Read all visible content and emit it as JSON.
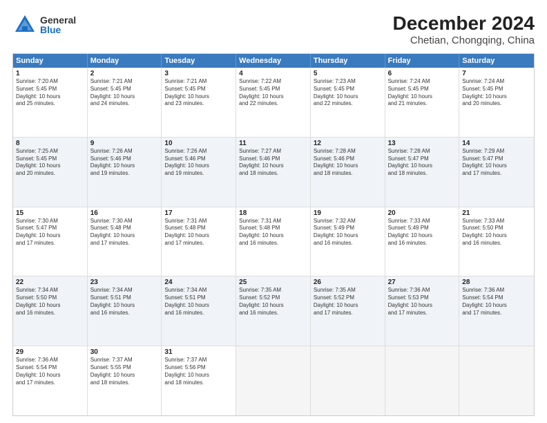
{
  "header": {
    "logo_general": "General",
    "logo_blue": "Blue",
    "title": "December 2024",
    "location": "Chetian, Chongqing, China"
  },
  "weekdays": [
    "Sunday",
    "Monday",
    "Tuesday",
    "Wednesday",
    "Thursday",
    "Friday",
    "Saturday"
  ],
  "rows": [
    [
      {
        "day": "1",
        "lines": [
          "Sunrise: 7:20 AM",
          "Sunset: 5:45 PM",
          "Daylight: 10 hours",
          "and 25 minutes."
        ]
      },
      {
        "day": "2",
        "lines": [
          "Sunrise: 7:21 AM",
          "Sunset: 5:45 PM",
          "Daylight: 10 hours",
          "and 24 minutes."
        ]
      },
      {
        "day": "3",
        "lines": [
          "Sunrise: 7:21 AM",
          "Sunset: 5:45 PM",
          "Daylight: 10 hours",
          "and 23 minutes."
        ]
      },
      {
        "day": "4",
        "lines": [
          "Sunrise: 7:22 AM",
          "Sunset: 5:45 PM",
          "Daylight: 10 hours",
          "and 22 minutes."
        ]
      },
      {
        "day": "5",
        "lines": [
          "Sunrise: 7:23 AM",
          "Sunset: 5:45 PM",
          "Daylight: 10 hours",
          "and 22 minutes."
        ]
      },
      {
        "day": "6",
        "lines": [
          "Sunrise: 7:24 AM",
          "Sunset: 5:45 PM",
          "Daylight: 10 hours",
          "and 21 minutes."
        ]
      },
      {
        "day": "7",
        "lines": [
          "Sunrise: 7:24 AM",
          "Sunset: 5:45 PM",
          "Daylight: 10 hours",
          "and 20 minutes."
        ]
      }
    ],
    [
      {
        "day": "8",
        "lines": [
          "Sunrise: 7:25 AM",
          "Sunset: 5:45 PM",
          "Daylight: 10 hours",
          "and 20 minutes."
        ]
      },
      {
        "day": "9",
        "lines": [
          "Sunrise: 7:26 AM",
          "Sunset: 5:46 PM",
          "Daylight: 10 hours",
          "and 19 minutes."
        ]
      },
      {
        "day": "10",
        "lines": [
          "Sunrise: 7:26 AM",
          "Sunset: 5:46 PM",
          "Daylight: 10 hours",
          "and 19 minutes."
        ]
      },
      {
        "day": "11",
        "lines": [
          "Sunrise: 7:27 AM",
          "Sunset: 5:46 PM",
          "Daylight: 10 hours",
          "and 18 minutes."
        ]
      },
      {
        "day": "12",
        "lines": [
          "Sunrise: 7:28 AM",
          "Sunset: 5:46 PM",
          "Daylight: 10 hours",
          "and 18 minutes."
        ]
      },
      {
        "day": "13",
        "lines": [
          "Sunrise: 7:28 AM",
          "Sunset: 5:47 PM",
          "Daylight: 10 hours",
          "and 18 minutes."
        ]
      },
      {
        "day": "14",
        "lines": [
          "Sunrise: 7:29 AM",
          "Sunset: 5:47 PM",
          "Daylight: 10 hours",
          "and 17 minutes."
        ]
      }
    ],
    [
      {
        "day": "15",
        "lines": [
          "Sunrise: 7:30 AM",
          "Sunset: 5:47 PM",
          "Daylight: 10 hours",
          "and 17 minutes."
        ]
      },
      {
        "day": "16",
        "lines": [
          "Sunrise: 7:30 AM",
          "Sunset: 5:48 PM",
          "Daylight: 10 hours",
          "and 17 minutes."
        ]
      },
      {
        "day": "17",
        "lines": [
          "Sunrise: 7:31 AM",
          "Sunset: 5:48 PM",
          "Daylight: 10 hours",
          "and 17 minutes."
        ]
      },
      {
        "day": "18",
        "lines": [
          "Sunrise: 7:31 AM",
          "Sunset: 5:48 PM",
          "Daylight: 10 hours",
          "and 16 minutes."
        ]
      },
      {
        "day": "19",
        "lines": [
          "Sunrise: 7:32 AM",
          "Sunset: 5:49 PM",
          "Daylight: 10 hours",
          "and 16 minutes."
        ]
      },
      {
        "day": "20",
        "lines": [
          "Sunrise: 7:33 AM",
          "Sunset: 5:49 PM",
          "Daylight: 10 hours",
          "and 16 minutes."
        ]
      },
      {
        "day": "21",
        "lines": [
          "Sunrise: 7:33 AM",
          "Sunset: 5:50 PM",
          "Daylight: 10 hours",
          "and 16 minutes."
        ]
      }
    ],
    [
      {
        "day": "22",
        "lines": [
          "Sunrise: 7:34 AM",
          "Sunset: 5:50 PM",
          "Daylight: 10 hours",
          "and 16 minutes."
        ]
      },
      {
        "day": "23",
        "lines": [
          "Sunrise: 7:34 AM",
          "Sunset: 5:51 PM",
          "Daylight: 10 hours",
          "and 16 minutes."
        ]
      },
      {
        "day": "24",
        "lines": [
          "Sunrise: 7:34 AM",
          "Sunset: 5:51 PM",
          "Daylight: 10 hours",
          "and 16 minutes."
        ]
      },
      {
        "day": "25",
        "lines": [
          "Sunrise: 7:35 AM",
          "Sunset: 5:52 PM",
          "Daylight: 10 hours",
          "and 16 minutes."
        ]
      },
      {
        "day": "26",
        "lines": [
          "Sunrise: 7:35 AM",
          "Sunset: 5:52 PM",
          "Daylight: 10 hours",
          "and 17 minutes."
        ]
      },
      {
        "day": "27",
        "lines": [
          "Sunrise: 7:36 AM",
          "Sunset: 5:53 PM",
          "Daylight: 10 hours",
          "and 17 minutes."
        ]
      },
      {
        "day": "28",
        "lines": [
          "Sunrise: 7:36 AM",
          "Sunset: 5:54 PM",
          "Daylight: 10 hours",
          "and 17 minutes."
        ]
      }
    ],
    [
      {
        "day": "29",
        "lines": [
          "Sunrise: 7:36 AM",
          "Sunset: 5:54 PM",
          "Daylight: 10 hours",
          "and 17 minutes."
        ]
      },
      {
        "day": "30",
        "lines": [
          "Sunrise: 7:37 AM",
          "Sunset: 5:55 PM",
          "Daylight: 10 hours",
          "and 18 minutes."
        ]
      },
      {
        "day": "31",
        "lines": [
          "Sunrise: 7:37 AM",
          "Sunset: 5:56 PM",
          "Daylight: 10 hours",
          "and 18 minutes."
        ]
      },
      {
        "day": "",
        "lines": []
      },
      {
        "day": "",
        "lines": []
      },
      {
        "day": "",
        "lines": []
      },
      {
        "day": "",
        "lines": []
      }
    ]
  ],
  "alt_rows": [
    1,
    3
  ]
}
